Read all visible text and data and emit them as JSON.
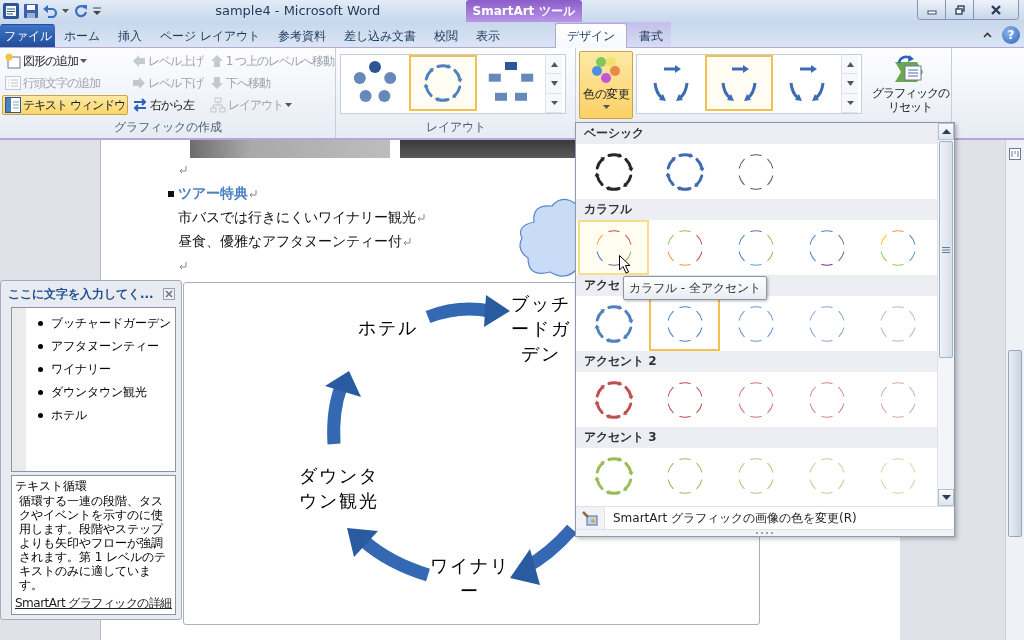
{
  "window": {
    "title": "sample4 - Microsoft Word",
    "context_group": "SmartArt ツール",
    "help": "?"
  },
  "tabs": [
    {
      "label": "ファイル",
      "kind": "file",
      "selected": false
    },
    {
      "label": "ホーム",
      "kind": "main",
      "selected": false
    },
    {
      "label": "挿入",
      "kind": "main",
      "selected": false
    },
    {
      "label": "ページ レイアウト",
      "kind": "main",
      "selected": false
    },
    {
      "label": "参考資料",
      "kind": "main",
      "selected": false
    },
    {
      "label": "差し込み文書",
      "kind": "main",
      "selected": false
    },
    {
      "label": "校閲",
      "kind": "main",
      "selected": false
    },
    {
      "label": "表示",
      "kind": "main",
      "selected": false
    },
    {
      "label": "デザイン",
      "kind": "context",
      "selected": true
    },
    {
      "label": "書式",
      "kind": "context",
      "selected": false
    }
  ],
  "ribbon": {
    "create_group": {
      "label": "グラフィックの作成",
      "items": [
        {
          "label": "図形の追加",
          "dropdown": true,
          "disabled": false,
          "pressed": false
        },
        {
          "label": "レベル上げ",
          "dropdown": false,
          "disabled": true,
          "pressed": false
        },
        {
          "label": "1 つ上のレベルへ移動",
          "dropdown": false,
          "disabled": true,
          "pressed": false
        },
        {
          "label": "行頭文字の追加",
          "dropdown": false,
          "disabled": true,
          "pressed": false
        },
        {
          "label": "レベル下げ",
          "dropdown": false,
          "disabled": true,
          "pressed": false
        },
        {
          "label": "下へ移動",
          "dropdown": false,
          "disabled": true,
          "pressed": false
        },
        {
          "label": "テキスト ウィンドウ",
          "dropdown": false,
          "disabled": false,
          "pressed": true
        },
        {
          "label": "右から左",
          "dropdown": false,
          "disabled": false,
          "pressed": false
        },
        {
          "label": "レイアウト",
          "dropdown": true,
          "disabled": true,
          "pressed": false
        }
      ]
    },
    "layout_group": {
      "label": "レイアウト",
      "thumbs": [
        {
          "selected": false
        },
        {
          "selected": true
        },
        {
          "selected": false
        }
      ]
    },
    "color_button": {
      "label": "色の変更",
      "open": true
    },
    "style_gallery": {
      "thumbs": [
        {
          "selected": false
        },
        {
          "selected": true
        },
        {
          "selected": false
        }
      ]
    },
    "reset_button": {
      "lines": [
        "グラフィックの",
        "リセット"
      ]
    }
  },
  "document": {
    "heading": "ツアー特典",
    "lines": [
      "市バスでは行きにくいワイナリー観光",
      "昼食、優雅なアフタヌーンティー付"
    ]
  },
  "diagram": {
    "nodes": [
      {
        "lines": [
          "ブッチ",
          "ードガ",
          "デン"
        ]
      },
      {
        "lines": [
          "ワイナリ",
          "ー"
        ]
      },
      {
        "lines": [
          "ダウンタ",
          "ウン観光"
        ]
      },
      {
        "lines": [
          "ホテル"
        ]
      }
    ]
  },
  "text_pane": {
    "title": "ここに文字を入力してく...",
    "items": [
      "ブッチャードガーデン",
      "アフタヌーンティー",
      "ワイナリー",
      "ダウンタウン観光",
      "ホテル"
    ],
    "description": {
      "title": "テキスト循環",
      "body": "循環する一連の段階、タスクやイベントを示すのに使用します。段階やステップよりも矢印やフローが強調されます。第 1 レベルのテキストのみに適しています。",
      "link": "SmartArt グラフィックの詳細"
    }
  },
  "color_menu": {
    "sections": [
      {
        "label": "ベーシック",
        "thumbs": [
          {
            "kind": "arrows",
            "selected": false,
            "hovered": false
          },
          {
            "kind": "arrows",
            "selected": false,
            "hovered": false
          },
          {
            "kind": "lines",
            "selected": false,
            "hovered": false
          }
        ]
      },
      {
        "label": "カラフル",
        "thumbs": [
          {
            "kind": "lines",
            "selected": false,
            "hovered": true
          },
          {
            "kind": "lines",
            "selected": false,
            "hovered": false
          },
          {
            "kind": "lines",
            "selected": false,
            "hovered": false
          },
          {
            "kind": "lines",
            "selected": false,
            "hovered": false
          },
          {
            "kind": "lines",
            "selected": false,
            "hovered": false
          }
        ]
      },
      {
        "label": "アクセ",
        "thumbs": [
          {
            "kind": "arrows",
            "selected": false,
            "hovered": false
          },
          {
            "kind": "lines",
            "selected": true,
            "hovered": false
          },
          {
            "kind": "lines",
            "selected": false,
            "hovered": false
          },
          {
            "kind": "lines",
            "selected": false,
            "hovered": false
          },
          {
            "kind": "lines",
            "selected": false,
            "hovered": false
          }
        ]
      },
      {
        "label": "アクセント 2",
        "thumbs": [
          {
            "kind": "arrows",
            "selected": false,
            "hovered": false
          },
          {
            "kind": "lines",
            "selected": false,
            "hovered": false
          },
          {
            "kind": "lines",
            "selected": false,
            "hovered": false
          },
          {
            "kind": "lines",
            "selected": false,
            "hovered": false
          },
          {
            "kind": "lines",
            "selected": false,
            "hovered": false
          }
        ]
      },
      {
        "label": "アクセント 3",
        "thumbs": [
          {
            "kind": "arrows",
            "selected": false,
            "hovered": false
          },
          {
            "kind": "lines",
            "selected": false,
            "hovered": false
          },
          {
            "kind": "lines",
            "selected": false,
            "hovered": false
          },
          {
            "kind": "lines",
            "selected": false,
            "hovered": false
          },
          {
            "kind": "lines",
            "selected": false,
            "hovered": false
          }
        ]
      }
    ],
    "footer": "SmartArt グラフィックの画像の色を変更(R)",
    "tooltip": "カラフル - 全アクセント"
  }
}
